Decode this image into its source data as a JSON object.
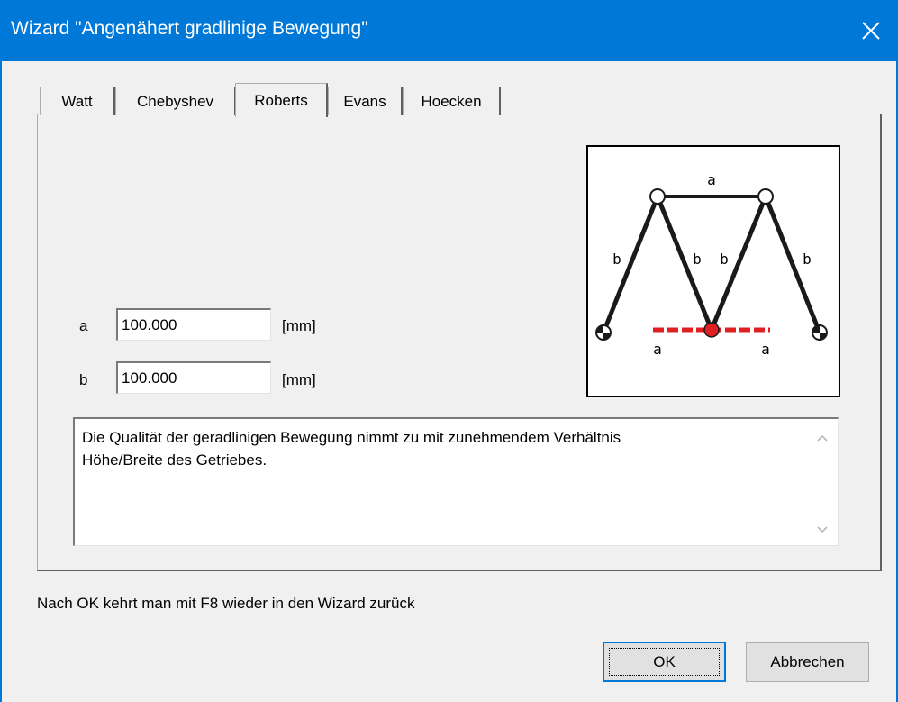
{
  "window": {
    "title": "Wizard \"Angenähert gradlinige Bewegung\"",
    "close_icon": "close-icon"
  },
  "tabs": [
    {
      "label": "Watt",
      "active": false
    },
    {
      "label": "Chebyshev",
      "active": false
    },
    {
      "label": "Roberts",
      "active": true
    },
    {
      "label": "Evans",
      "active": false
    },
    {
      "label": "Hoecken",
      "active": false
    }
  ],
  "fields": {
    "a": {
      "label": "a",
      "value": "100.000",
      "unit": "[mm]"
    },
    "b": {
      "label": "b",
      "value": "100.000",
      "unit": "[mm]"
    }
  },
  "diagram": {
    "top_label": "a",
    "link_labels": [
      "b",
      "b",
      "b",
      "b"
    ],
    "bottom_labels": [
      "a",
      "a"
    ],
    "colors": {
      "links": "#1a1a1a",
      "coupler_point": "#e02020",
      "trace": "#e02020"
    }
  },
  "memo": {
    "line1": "Die Qualität der geradlinigen Bewegung nimmt zu mit zunehmendem Verhältnis",
    "line2": "Höhe/Breite des Getriebes."
  },
  "hint": "Nach OK kehrt man mit F8 wieder in den Wizard zurück",
  "buttons": {
    "ok": "OK",
    "cancel": "Abbrechen"
  },
  "colors": {
    "titlebar": "#0078d7",
    "background": "#f0f0f0"
  }
}
